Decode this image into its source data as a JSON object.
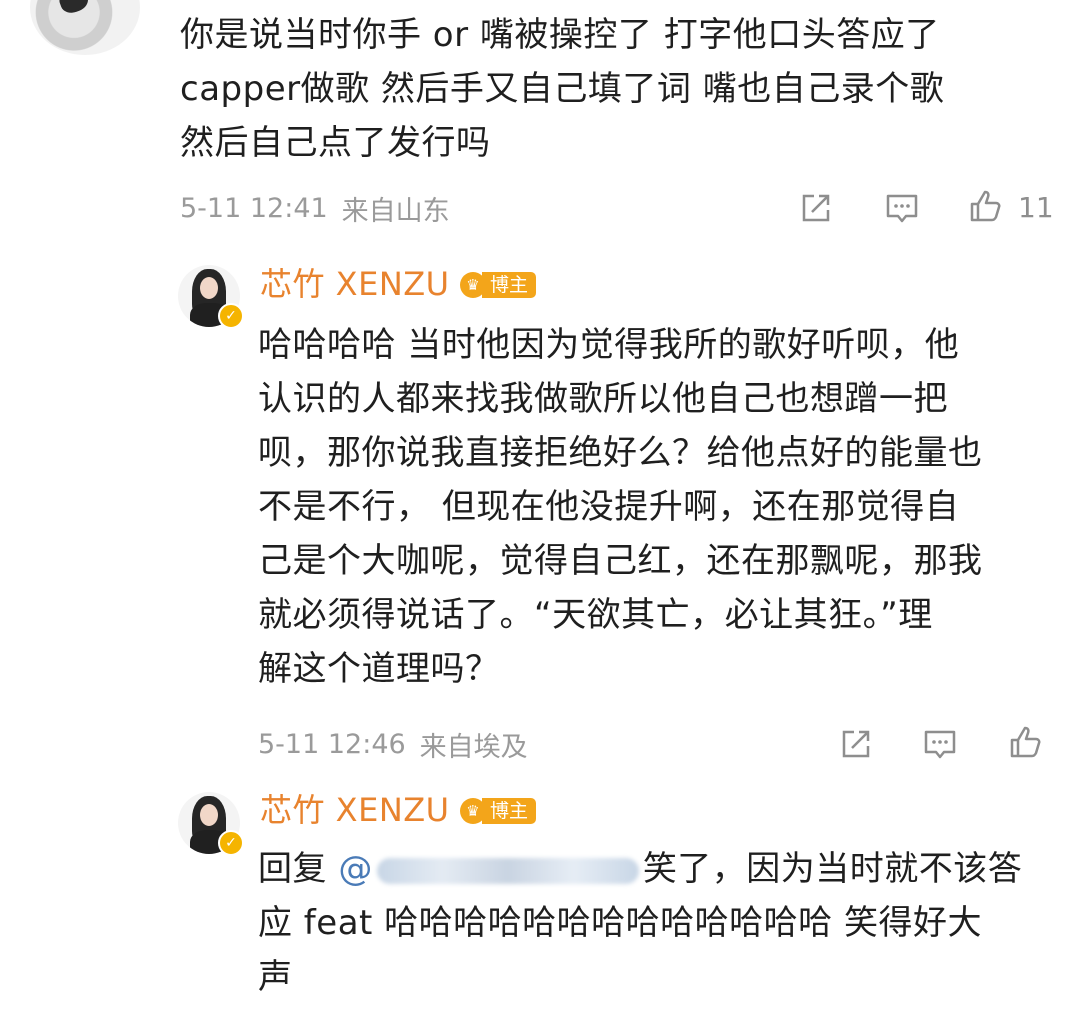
{
  "top_comment": {
    "text": "你是说当时你手 or 嘴被操控了 打字他口头答应了\ncapper做歌 然后手又自己填了词 嘴也自己录个歌\n然后自己点了发行吗",
    "time": "5-11 12:41",
    "location": "来自山东",
    "like_count": "11"
  },
  "reply1": {
    "username": "芯竹 XENZU",
    "badge_label": "博主",
    "text": "哈哈哈哈 当时他因为觉得我所的歌好听呗，他\n认识的人都来找我做歌所以他自己也想蹭一把\n呗，那你说我直接拒绝好么？给他点好的能量也\n不是不行， 但现在他没提升啊，还在那觉得自\n己是个大咖呢，觉得自己红，还在那飘呢，那我\n就必须得说话了。“天欲其亡，必让其狂。”理\n解这个道理吗？",
    "time": "5-11 12:46",
    "location": "来自埃及"
  },
  "reply2": {
    "username": "芯竹 XENZU",
    "badge_label": "博主",
    "reply_prefix": "回复",
    "mention_at": "@",
    "after_mention": "笑了，因为当时就不该答",
    "text_rest": "应 feat 哈哈哈哈哈哈哈哈哈哈哈哈哈 笑得好大\n声"
  },
  "icons": [
    "share-icon",
    "comment-icon",
    "like-icon",
    "verified-icon",
    "crown-icon"
  ],
  "colors": {
    "username": "#e8832e",
    "meta": "#9a9a9a",
    "badge": "#f3a51a",
    "mention": "#4a7bb7"
  }
}
